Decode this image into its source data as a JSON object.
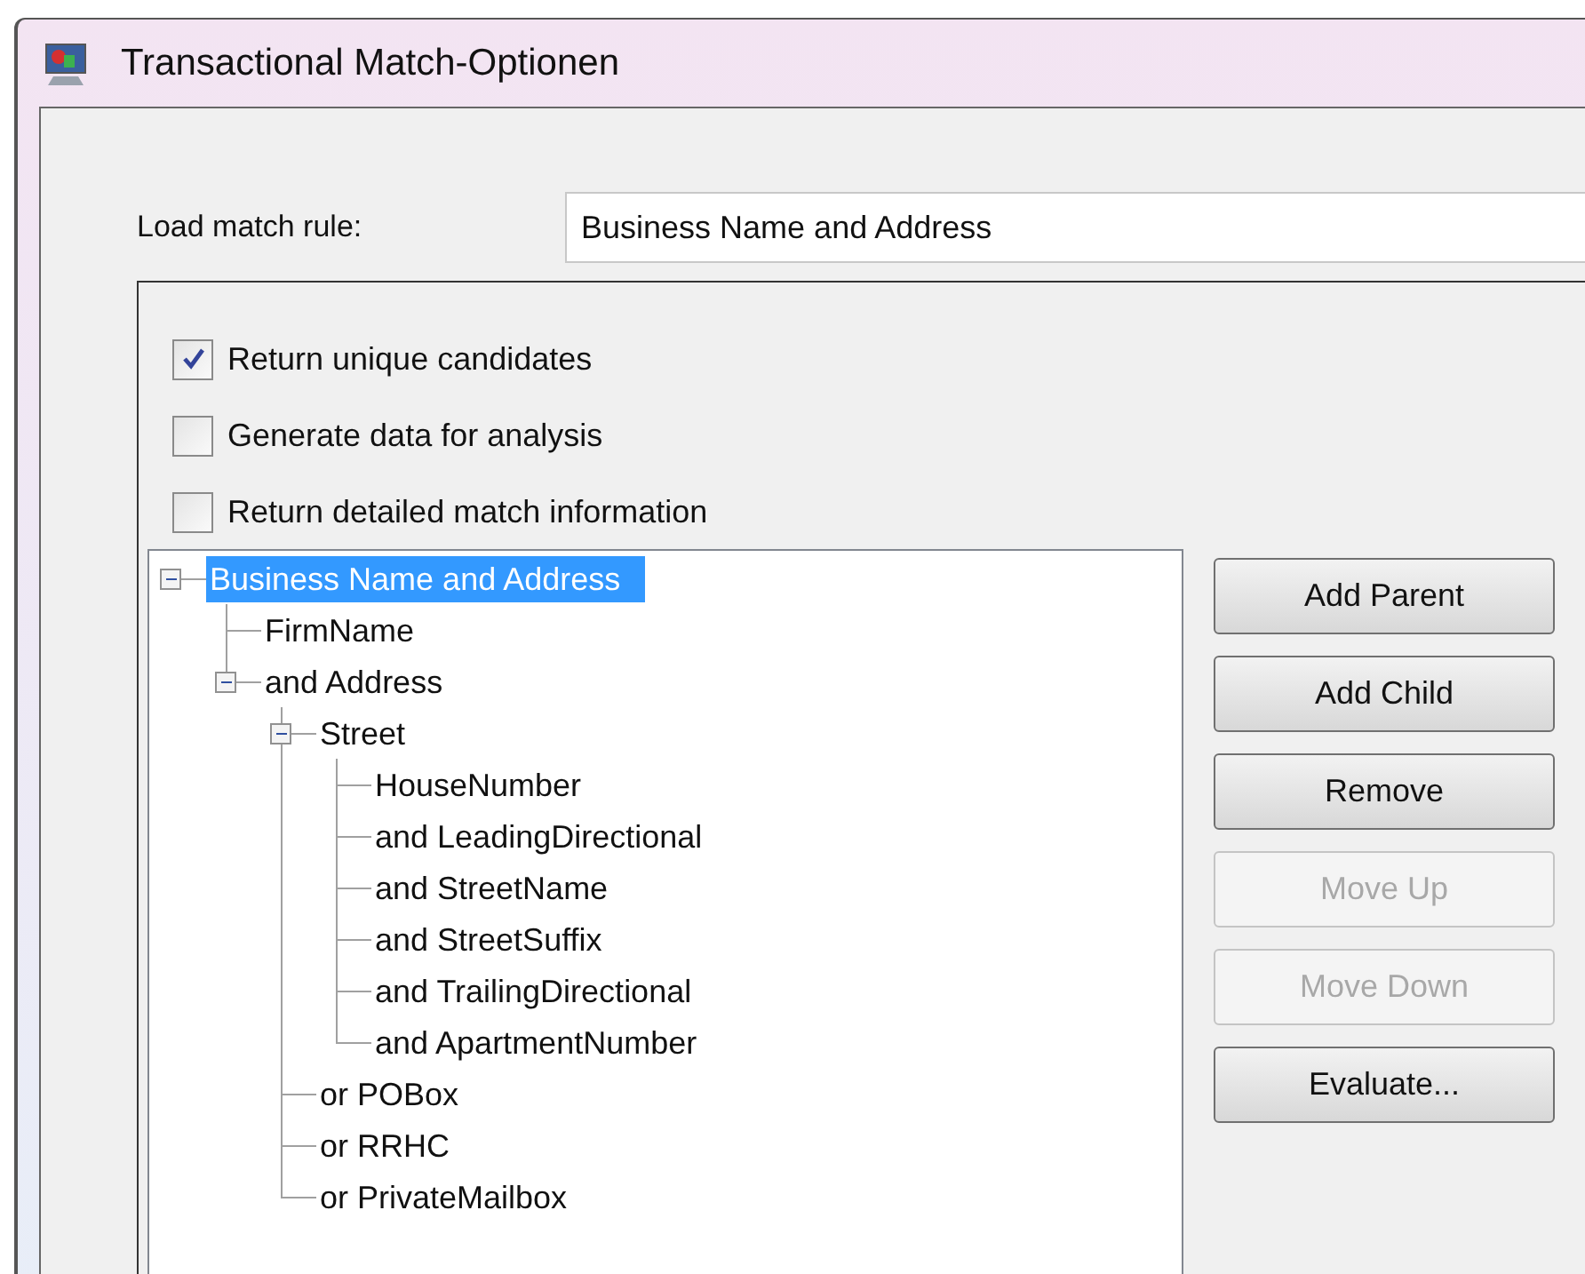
{
  "window": {
    "title": "Transactional Match-Optionen"
  },
  "load_rule": {
    "label": "Load match rule:",
    "value": "Business Name and Address"
  },
  "options": [
    {
      "label": "Return unique candidates",
      "checked": true
    },
    {
      "label": "Generate data for analysis",
      "checked": false
    },
    {
      "label": "Return detailed match information",
      "checked": false
    }
  ],
  "tree": [
    {
      "label": "Business Name and Address",
      "selected": true,
      "expanded": true,
      "children": [
        {
          "label": "FirmName",
          "selected": false
        },
        {
          "label": "and Address",
          "selected": false,
          "expanded": true,
          "children": [
            {
              "label": "Street",
              "selected": false,
              "expanded": true,
              "children": [
                {
                  "label": "HouseNumber",
                  "selected": false
                },
                {
                  "label": "and LeadingDirectional",
                  "selected": false
                },
                {
                  "label": "and StreetName",
                  "selected": false
                },
                {
                  "label": "and StreetSuffix",
                  "selected": false
                },
                {
                  "label": "and TrailingDirectional",
                  "selected": false
                },
                {
                  "label": "and ApartmentNumber",
                  "selected": false
                }
              ]
            },
            {
              "label": "or POBox",
              "selected": false
            },
            {
              "label": "or RRHC",
              "selected": false
            },
            {
              "label": "or PrivateMailbox",
              "selected": false
            }
          ]
        }
      ]
    }
  ],
  "buttons": [
    {
      "label": "Add Parent",
      "disabled": false
    },
    {
      "label": "Add Child",
      "disabled": false
    },
    {
      "label": "Remove",
      "disabled": false
    },
    {
      "label": "Move Up",
      "disabled": true
    },
    {
      "label": "Move Down",
      "disabled": true
    },
    {
      "label": "Evaluate...",
      "disabled": false
    }
  ]
}
